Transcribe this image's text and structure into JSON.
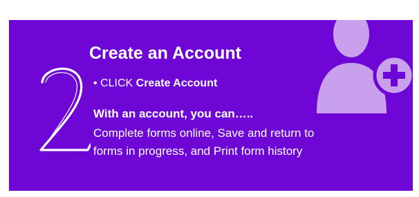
{
  "step": {
    "number": "2"
  },
  "header": {
    "title": "Create an Account"
  },
  "instruction": {
    "bullet": "•",
    "prefix": "CLICK",
    "action": "Create Account"
  },
  "benefits": {
    "heading": "With an account, you can…..",
    "line1": "Complete forms online, Save and return to",
    "line2": "forms in progress, and Print form history"
  },
  "icons": {
    "add_user": "add-user-icon",
    "plus": "plus-icon"
  },
  "colors": {
    "background": "#6e06d6",
    "text": "#ffffff",
    "icon_light": "#c9a0ec",
    "icon_plus_bg": "#c9a0ec"
  }
}
